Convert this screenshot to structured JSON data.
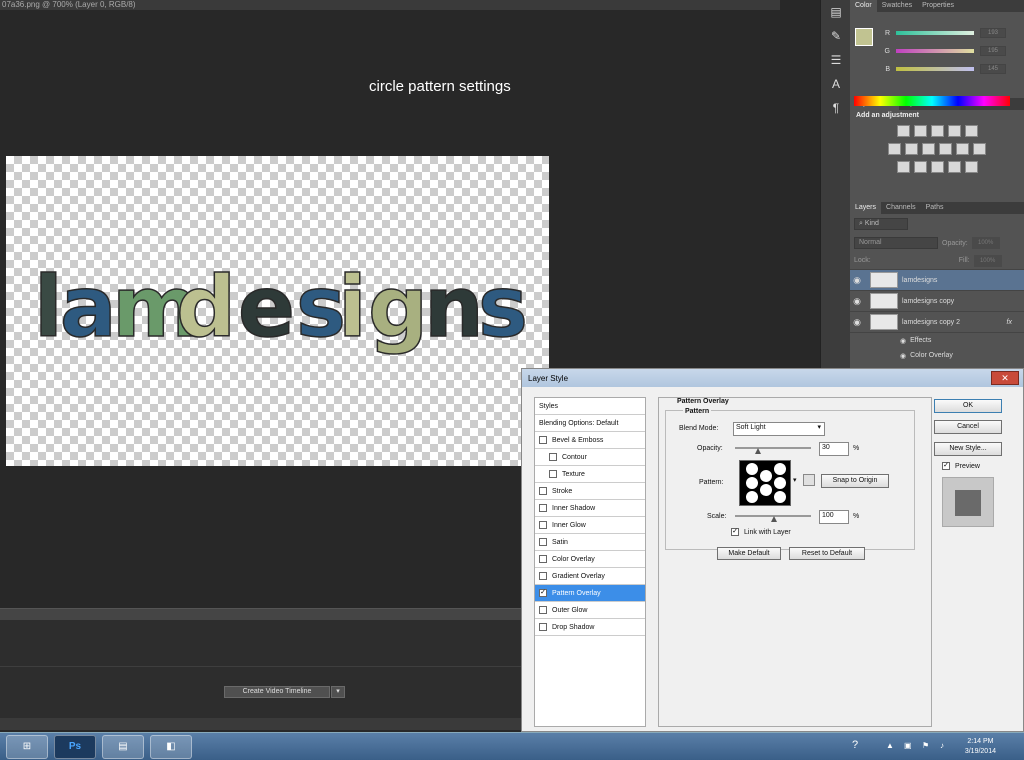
{
  "document": {
    "tab_title": "07a36.png @ 700% (Layer 0, RGB/8)"
  },
  "annotation": "circle pattern settings",
  "canvas_text": "lamdesigns",
  "logo_colors": [
    "#3a4a44",
    "#2e5a80",
    "#6a9a6a",
    "#bcc090",
    "#2e3a38",
    "#2e5a80",
    "#bcc090",
    "#a8b080",
    "#2e3a38",
    "#2e5a80"
  ],
  "timeline": {
    "create_button": "Create Video Timeline",
    "dropdown": "▾"
  },
  "dock_icons": [
    "tools-icon",
    "brush-icon",
    "sliders-icon",
    "text-icon",
    "paragraph-icon"
  ],
  "color_panel": {
    "tabs": [
      "Color",
      "Swatches",
      "Properties"
    ],
    "sliders": [
      {
        "label": "R",
        "value": "193",
        "gradient": "#2ec09a"
      },
      {
        "label": "G",
        "value": "195",
        "gradient": "#c070c0"
      },
      {
        "label": "B",
        "value": "145",
        "gradient": "#c0c070"
      }
    ]
  },
  "adjustments_panel": {
    "tabs": [
      "Adjustments",
      "Styles"
    ],
    "heading": "Add an adjustment"
  },
  "layers_panel": {
    "tabs": [
      "Layers",
      "Channels",
      "Paths"
    ],
    "filter": "Kind",
    "blend": "Normal",
    "opacity_label": "Opacity:",
    "opacity_value": "100%",
    "lock_label": "Lock:",
    "fill_label": "Fill:",
    "fill_value": "100%",
    "layers": [
      {
        "name": "lamdesigns",
        "selected": true
      },
      {
        "name": "lamdesigns copy",
        "selected": false
      },
      {
        "name": "lamdesigns copy 2",
        "selected": false
      }
    ],
    "effects_label": "Effects",
    "effect_item": "Color Overlay"
  },
  "dialog": {
    "title": "Layer Style",
    "styles_header": "Styles",
    "blending": "Blending Options: Default",
    "items": [
      {
        "label": "Bevel & Emboss",
        "checked": false,
        "indent": false,
        "selected": false
      },
      {
        "label": "Contour",
        "checked": false,
        "indent": true,
        "selected": false
      },
      {
        "label": "Texture",
        "checked": false,
        "indent": true,
        "selected": false
      },
      {
        "label": "Stroke",
        "checked": false,
        "indent": false,
        "selected": false
      },
      {
        "label": "Inner Shadow",
        "checked": false,
        "indent": false,
        "selected": false
      },
      {
        "label": "Inner Glow",
        "checked": false,
        "indent": false,
        "selected": false
      },
      {
        "label": "Satin",
        "checked": false,
        "indent": false,
        "selected": false
      },
      {
        "label": "Color Overlay",
        "checked": false,
        "indent": false,
        "selected": false
      },
      {
        "label": "Gradient Overlay",
        "checked": false,
        "indent": false,
        "selected": false
      },
      {
        "label": "Pattern Overlay",
        "checked": true,
        "indent": false,
        "selected": true
      },
      {
        "label": "Outer Glow",
        "checked": false,
        "indent": false,
        "selected": false
      },
      {
        "label": "Drop Shadow",
        "checked": false,
        "indent": false,
        "selected": false
      }
    ],
    "section_title": "Pattern Overlay",
    "group_title": "Pattern",
    "blend_mode_label": "Blend Mode:",
    "blend_mode_value": "Soft Light",
    "opacity_label": "Opacity:",
    "opacity_value": "30",
    "opacity_level": 0.3,
    "percent": "%",
    "pattern_label": "Pattern:",
    "snap_button": "Snap to Origin",
    "scale_label": "Scale:",
    "scale_value": "100",
    "link_label": "Link with Layer",
    "link_checked": true,
    "make_default": "Make Default",
    "reset_default": "Reset to Default",
    "ok": "OK",
    "cancel": "Cancel",
    "new_style": "New Style...",
    "preview_label": "Preview",
    "preview_checked": true
  },
  "taskbar": {
    "apps": [
      "Ps"
    ],
    "time": "2:14 PM",
    "date": "3/19/2014"
  }
}
